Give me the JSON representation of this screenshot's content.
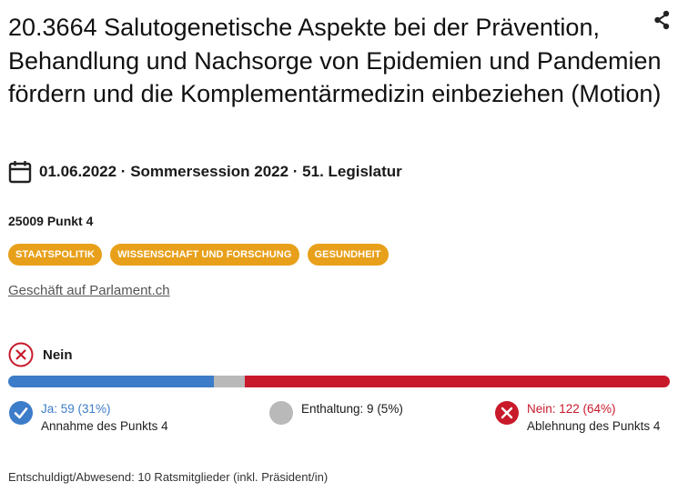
{
  "affair": {
    "title": "20.3664 Salutogenetische Aspekte bei der Prävention, Behandlung und Nachsorge von Epidemien und Pandemien fördern und die Komplementärmedizin einbeziehen (Motion)",
    "date_line": "01.06.2022 · Sommersession 2022 · 51. Legislatur",
    "item": "25009 Punkt 4",
    "tags": [
      "STAATSPOLITIK",
      "WISSENSCHAFT UND FORSCHUNG",
      "GESUNDHEIT"
    ],
    "link_label": "Geschäft auf Parlament.ch"
  },
  "result": {
    "label": "Nein",
    "yes_label": "Ja: 59 (31%)",
    "yes_sub": "Annahme des Punkts 4",
    "abstain_label": "Enthaltung: 9 (5%)",
    "no_label": "Nein: 122 (64%)",
    "no_sub": "Ablehnung des Punkts 4",
    "absent_text": "Entschuldigt/Abwesend: 10 Ratsmitglieder (inkl. Präsident/in)"
  },
  "vote_counts": {
    "yes": 59,
    "abstain": 9,
    "no": 122
  },
  "colors": {
    "yes": "#3d7cc9",
    "abstain": "#b9b9b9",
    "no": "#c81a2b",
    "tag": "#e8a01a"
  },
  "icons": {
    "share": "share-icon",
    "calendar": "calendar-icon",
    "result": "x-circle-icon",
    "yes": "check-circle-icon",
    "abstain": "circle-icon",
    "no": "x-circle-filled-icon"
  }
}
